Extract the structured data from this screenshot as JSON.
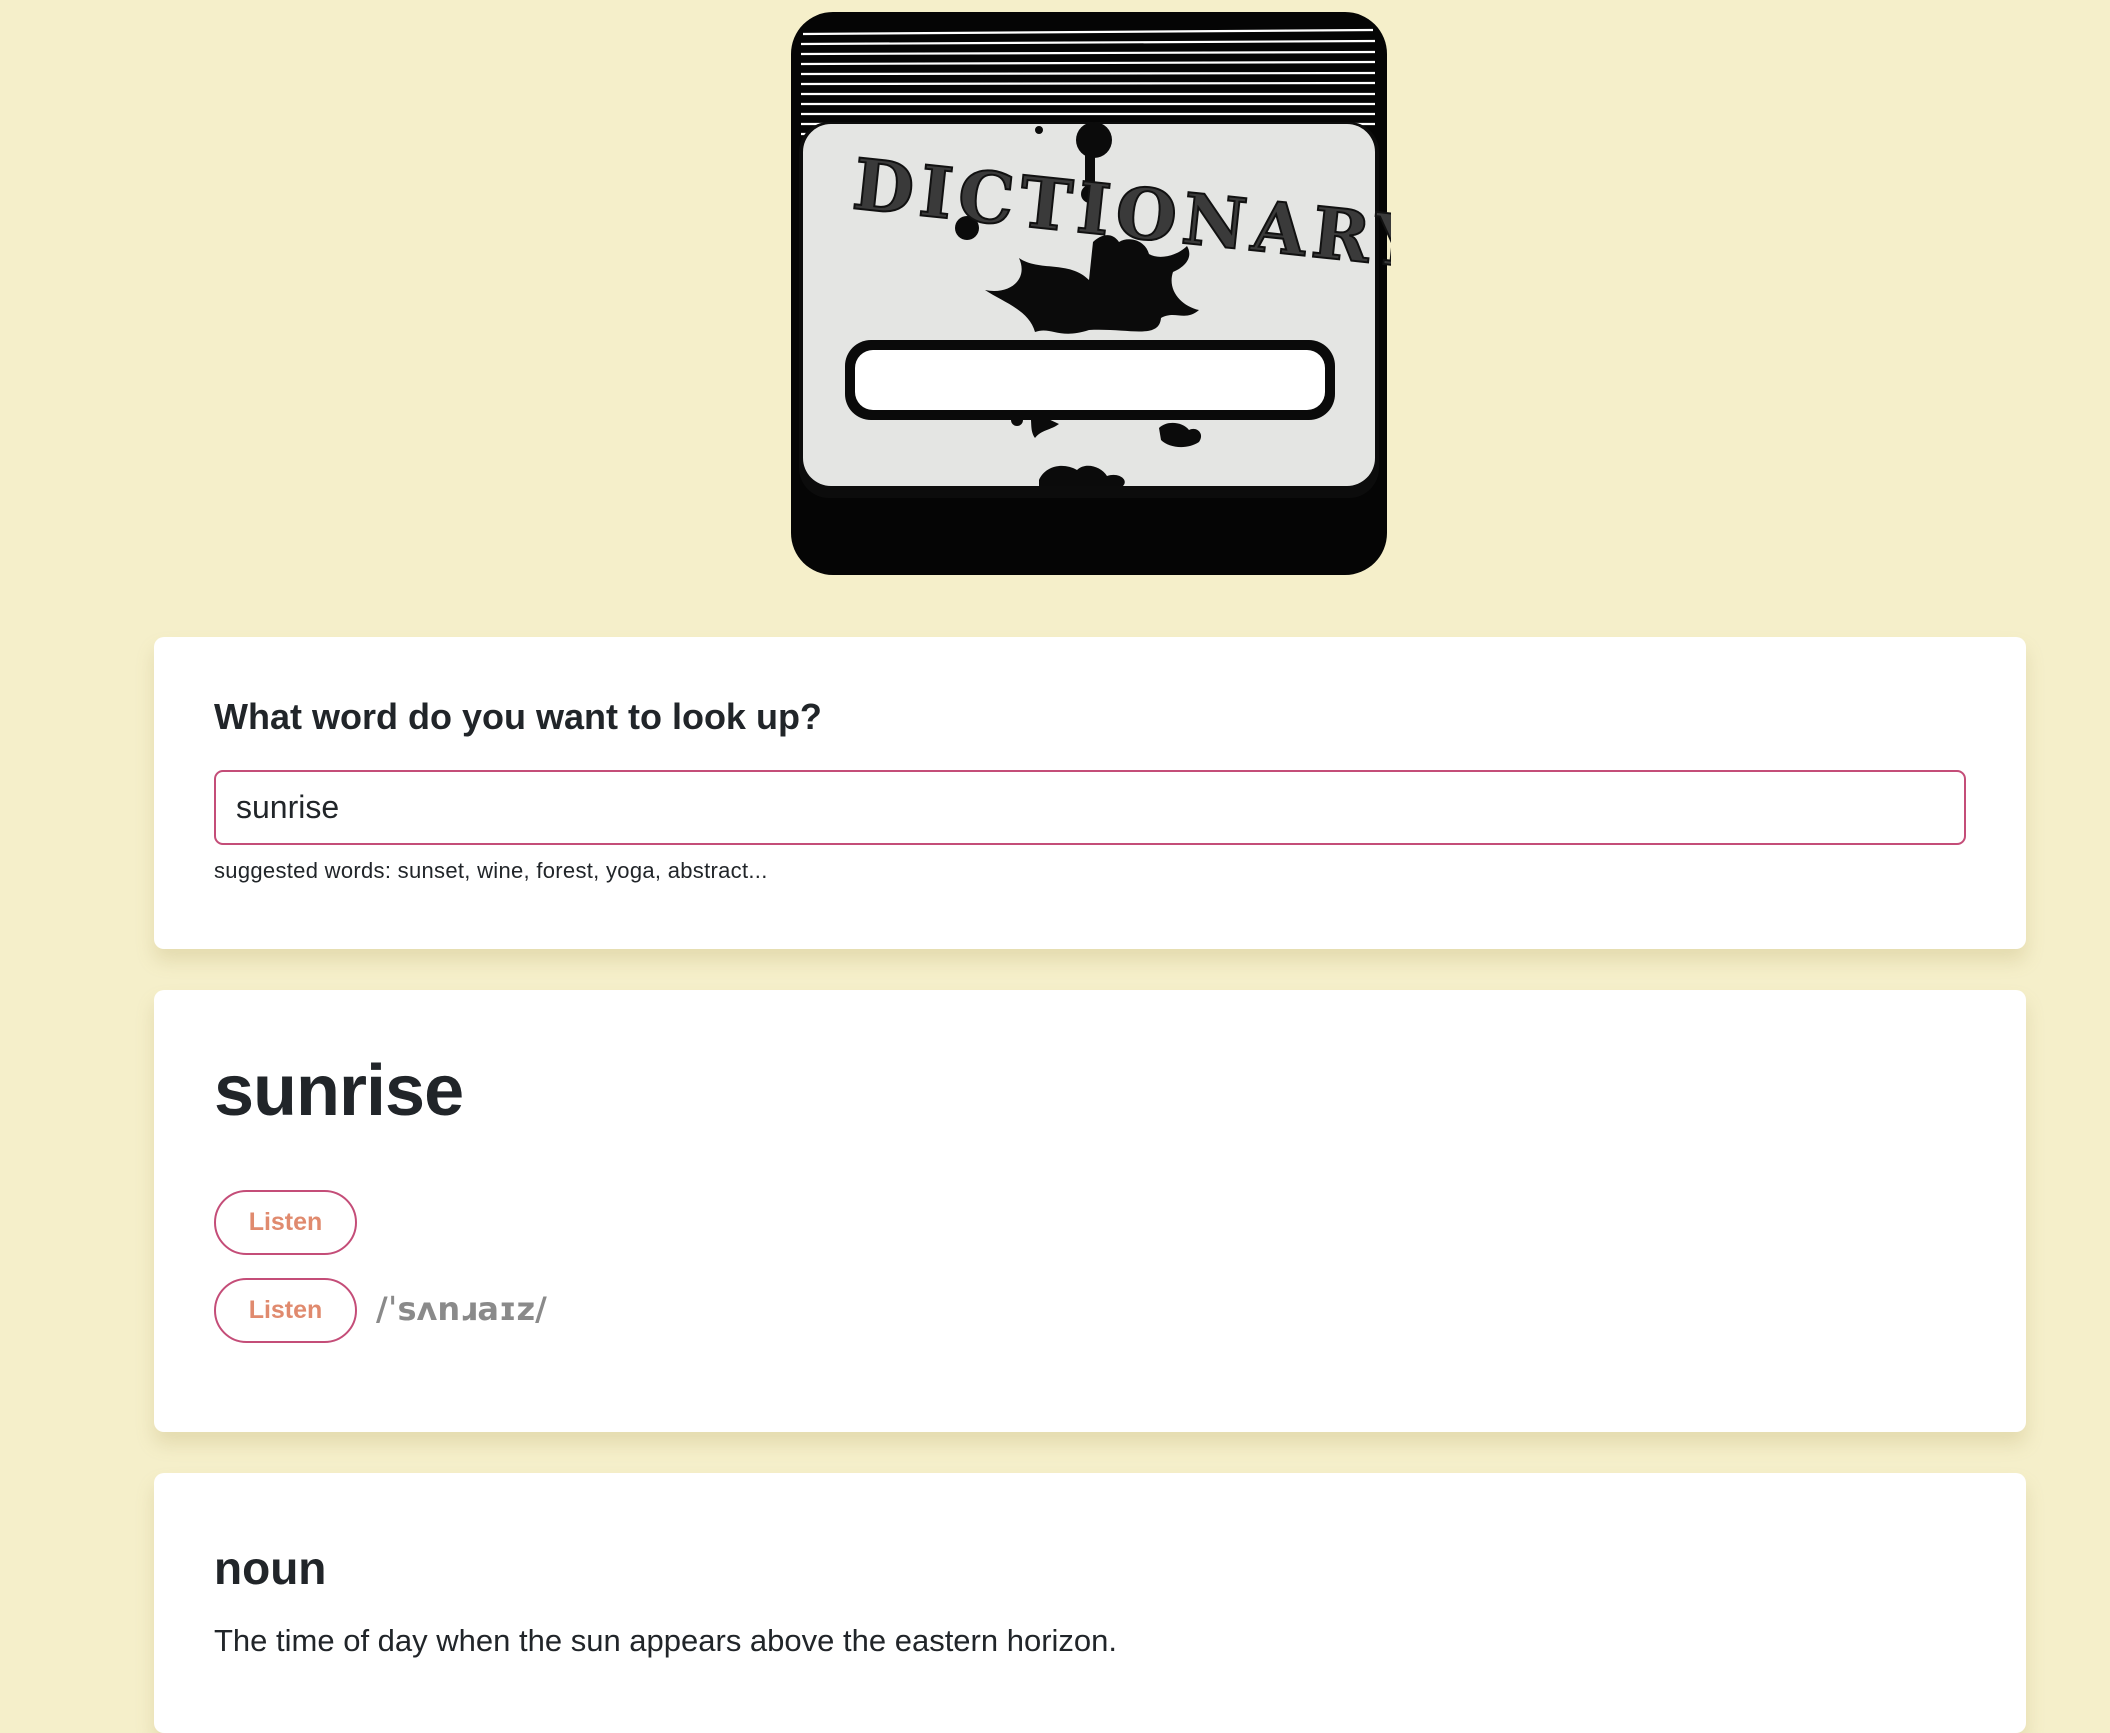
{
  "logo": {
    "text": "DICTIONARY",
    "icon": "dictionary-book-logo"
  },
  "search": {
    "heading": "What word do you want to look up?",
    "value": "sunrise",
    "hint": "suggested words: sunset, wine, forest, yoga, abstract..."
  },
  "result": {
    "word": "sunrise",
    "listen_label_1": "Listen",
    "listen_label_2": "Listen",
    "phonetic": "/ˈsʌnɹaɪz/"
  },
  "meaning": {
    "part_of_speech": "noun",
    "definition": "The time of day when the sun appears above the eastern horizon."
  },
  "colors": {
    "background": "#f5efca",
    "accent_border": "#c44d78",
    "button_text": "#e08a6e"
  }
}
